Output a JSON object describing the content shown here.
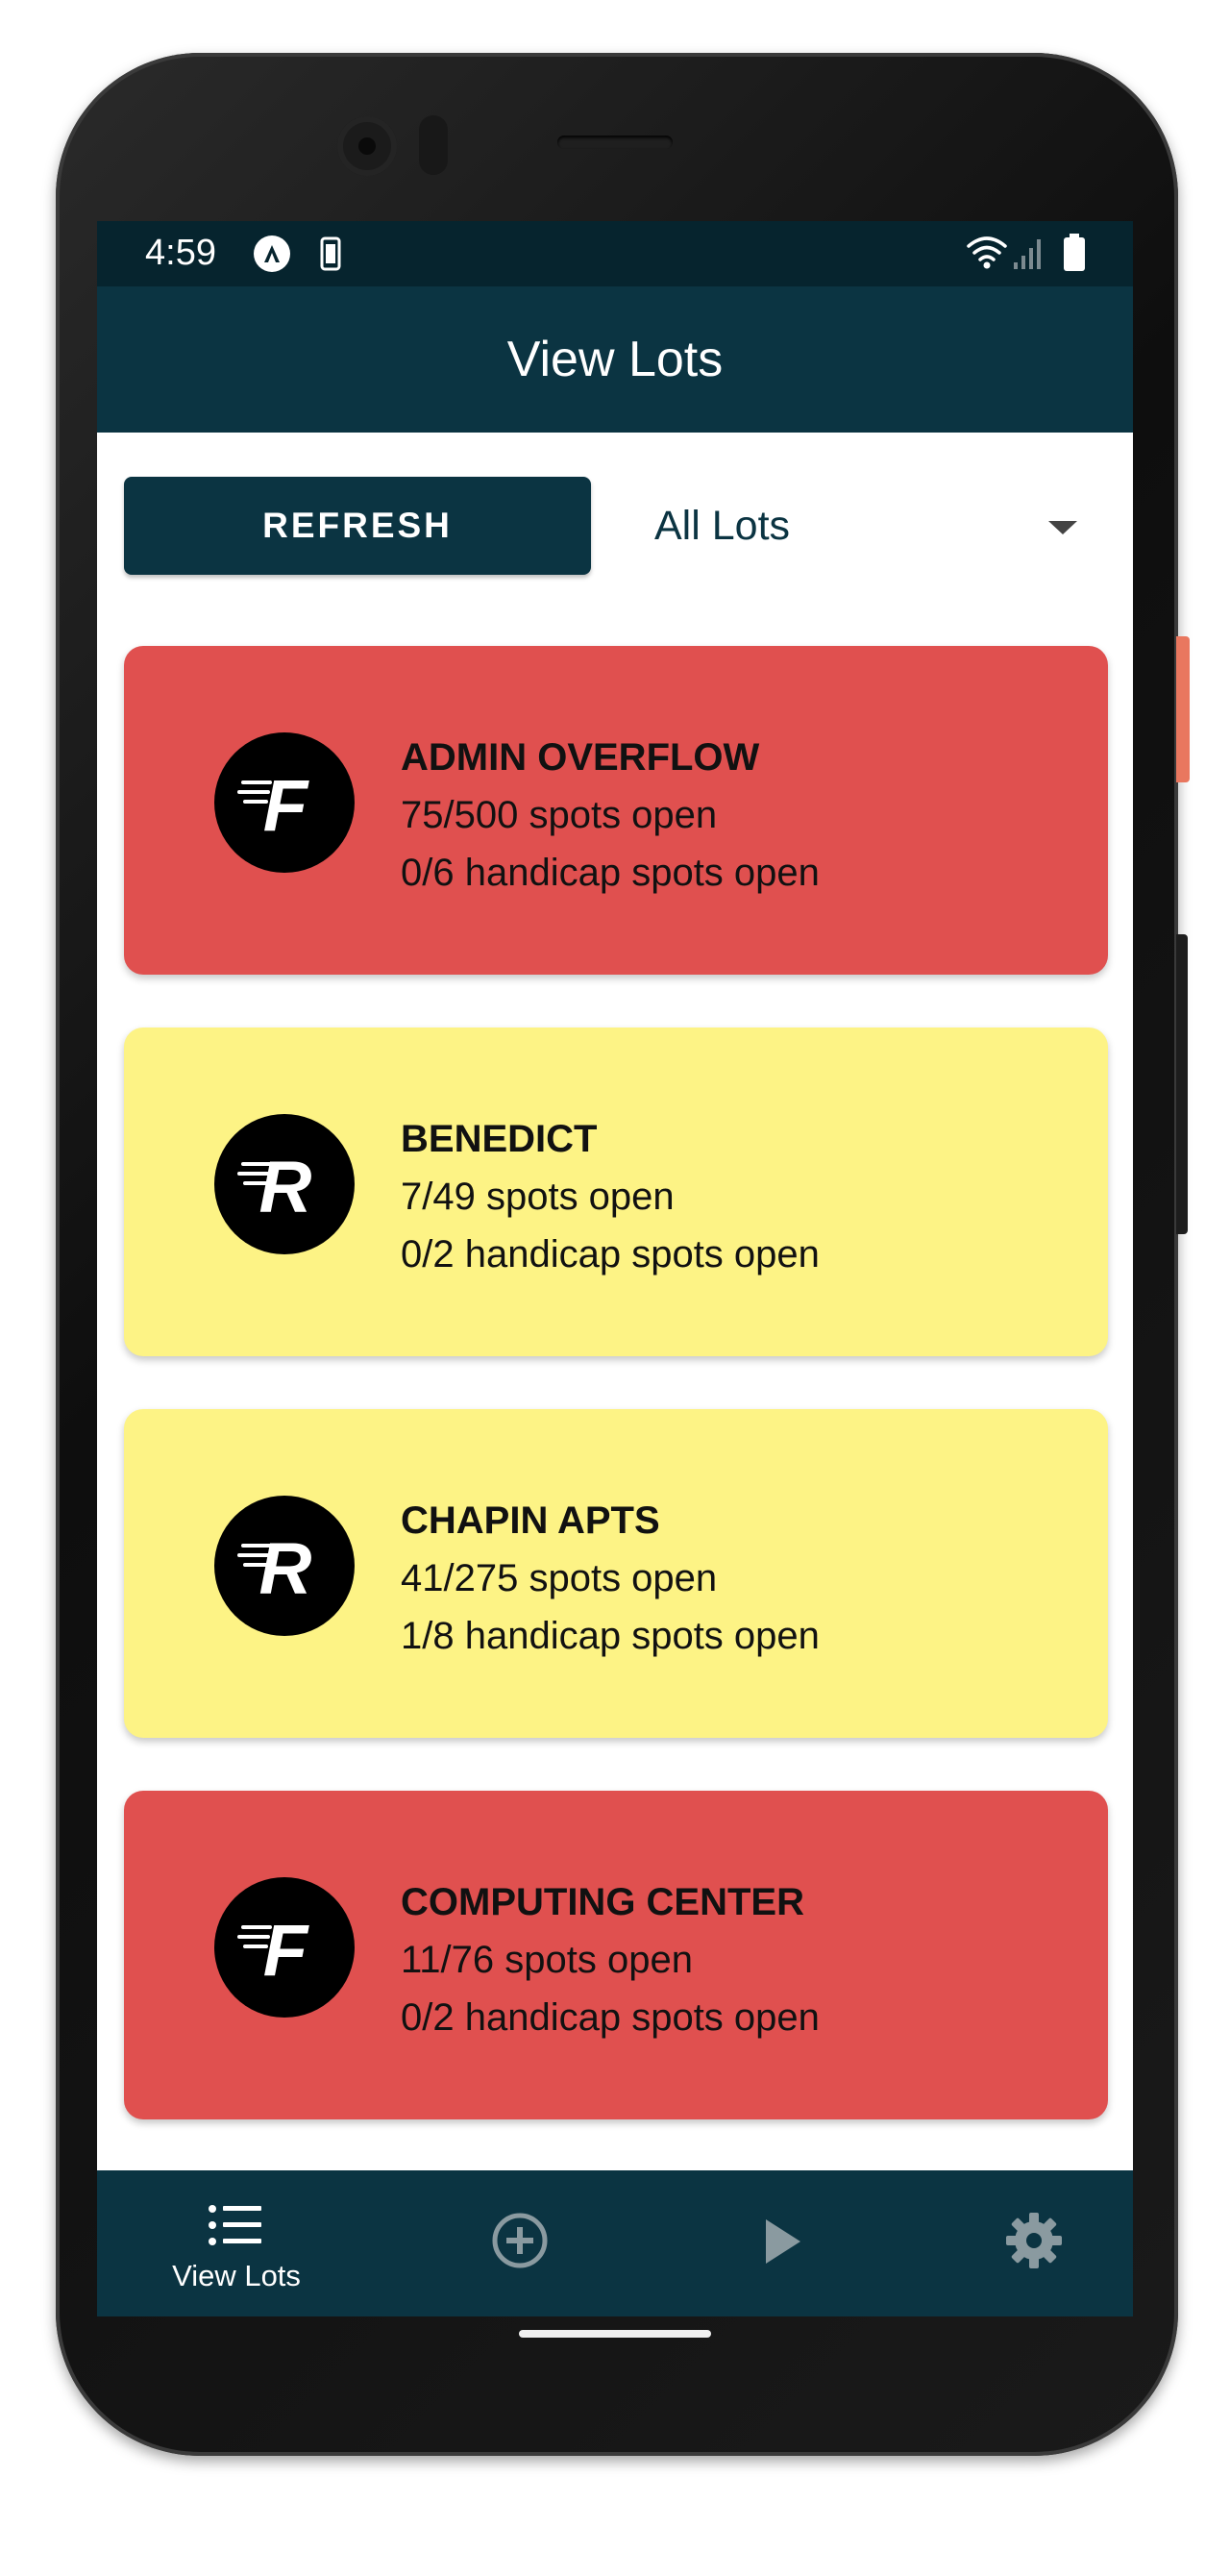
{
  "status_bar": {
    "time": "4:59",
    "icons": [
      "auto-brightness-icon",
      "phone-storage-icon",
      "wifi-icon",
      "signal-icon",
      "battery-icon"
    ]
  },
  "app_bar": {
    "title": "View Lots"
  },
  "toolbar": {
    "refresh_label": "REFRESH",
    "lot_filter": {
      "selected": "All Lots"
    }
  },
  "lots": [
    {
      "name": "ADMIN OVERFLOW",
      "spots": "75/500 spots open",
      "handicap": "0/6 handicap spots open",
      "logo_letter": "F",
      "color": "#e0504f"
    },
    {
      "name": "BENEDICT",
      "spots": "7/49 spots open",
      "handicap": "0/2 handicap spots open",
      "logo_letter": "R",
      "color": "#fdf385"
    },
    {
      "name": "CHAPIN APTS",
      "spots": "41/275 spots open",
      "handicap": "1/8 handicap spots open",
      "logo_letter": "R",
      "color": "#fdf385"
    },
    {
      "name": "COMPUTING CENTER",
      "spots": "11/76 spots open",
      "handicap": "0/2 handicap spots open",
      "logo_letter": "F",
      "color": "#e0504f"
    }
  ],
  "bottom_nav": {
    "items": [
      {
        "label": "View Lots",
        "icon": "list-icon",
        "active": true
      },
      {
        "label": "",
        "icon": "add-circle-icon",
        "active": false
      },
      {
        "label": "",
        "icon": "play-icon",
        "active": false
      },
      {
        "label": "",
        "icon": "settings-gear-icon",
        "active": false
      }
    ]
  },
  "colors": {
    "app_bar": "#0b3442",
    "status_bar": "#06242e",
    "full_lot": "#e0504f",
    "busy_lot": "#fdf385",
    "inactive_nav_icon": "#8a9aa0"
  }
}
